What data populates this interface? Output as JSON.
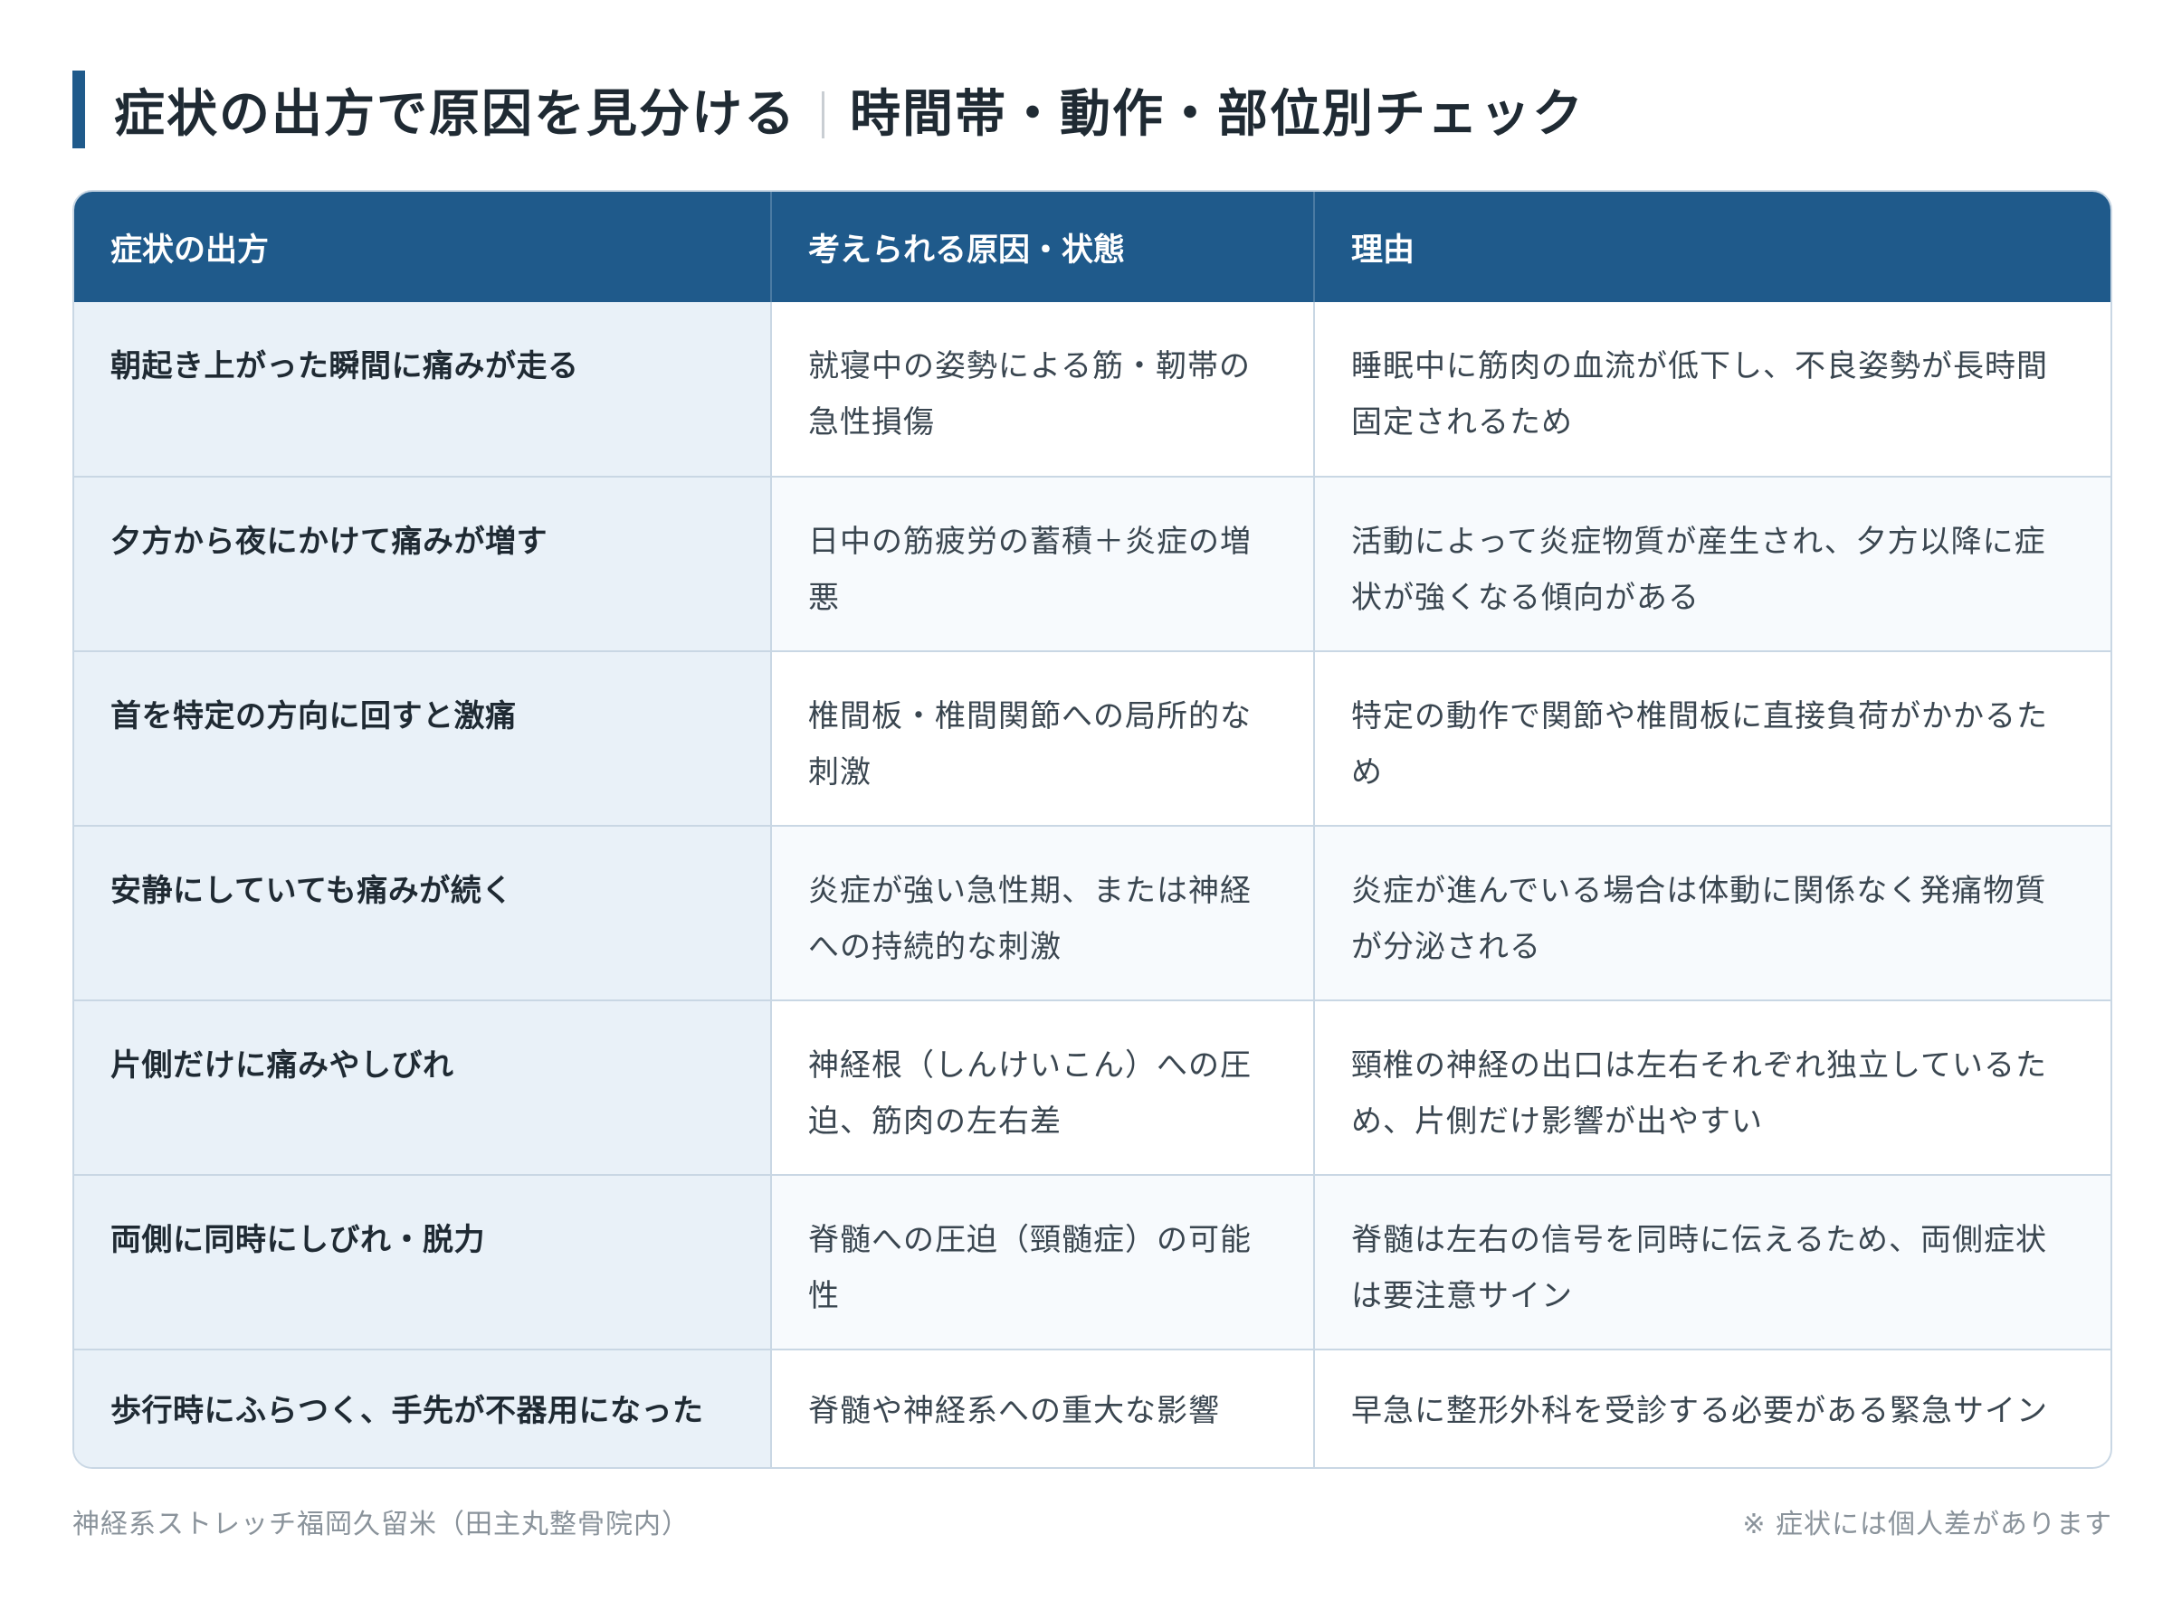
{
  "header": {
    "title_main": "症状の出方で原因を見分ける",
    "title_sub": "時間帯・動作・部位別チェック"
  },
  "table": {
    "columns": [
      "症状の出方",
      "考えられる原因・状態",
      "理由"
    ],
    "rows": [
      {
        "symptom": "朝起き上がった瞬間に痛みが走る",
        "cause": "就寝中の姿勢による筋・靭帯の急性損傷",
        "reason": "睡眠中に筋肉の血流が低下し、不良姿勢が長時間固定されるため"
      },
      {
        "symptom": "夕方から夜にかけて痛みが増す",
        "cause": "日中の筋疲労の蓄積＋炎症の増悪",
        "reason": "活動によって炎症物質が産生され、夕方以降に症状が強くなる傾向がある"
      },
      {
        "symptom": "首を特定の方向に回すと激痛",
        "cause": "椎間板・椎間関節への局所的な刺激",
        "reason": "特定の動作で関節や椎間板に直接負荷がかかるため"
      },
      {
        "symptom": "安静にしていても痛みが続く",
        "cause": "炎症が強い急性期、または神経への持続的な刺激",
        "reason": "炎症が進んでいる場合は体動に関係なく発痛物質が分泌される"
      },
      {
        "symptom": "片側だけに痛みやしびれ",
        "cause": "神経根（しんけいこん）への圧迫、筋肉の左右差",
        "reason": "頸椎の神経の出口は左右それぞれ独立しているため、片側だけ影響が出やすい"
      },
      {
        "symptom": "両側に同時にしびれ・脱力",
        "cause": "脊髄への圧迫（頸髄症）の可能性",
        "reason": "脊髄は左右の信号を同時に伝えるため、両側症状は要注意サイン"
      },
      {
        "symptom": "歩行時にふらつく、手先が不器用になった",
        "cause": "脊髄や神経系への重大な影響",
        "reason": "早急に整形外科を受診する必要がある緊急サイン"
      }
    ]
  },
  "footer": {
    "source": "神経系ストレッチ福岡久留米（田主丸整骨院内）",
    "note": "※ 症状には個人差があります"
  },
  "colors": {
    "accent": "#1f5a8b",
    "symptom_bg": "#e9f1f8",
    "border": "#c9d7e4"
  }
}
